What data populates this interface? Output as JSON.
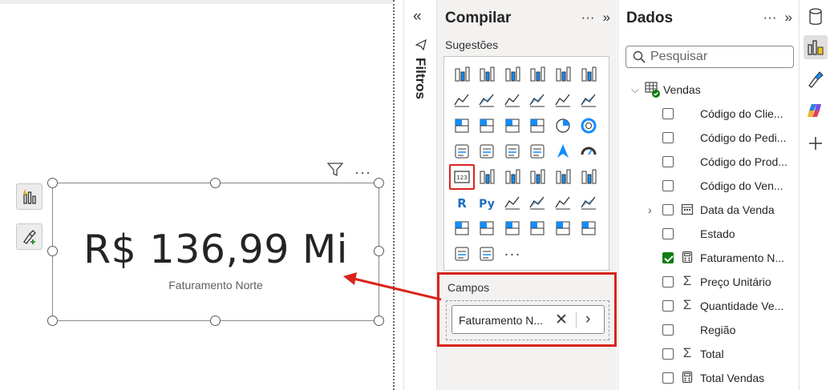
{
  "card": {
    "value": "R$ 136,99 Mi",
    "label": "Faturamento Norte"
  },
  "visual_header": {
    "filter_icon": "funnel-icon",
    "more_label": "···"
  },
  "filters_pane": {
    "title": "Filtros",
    "collapse_label": "«"
  },
  "build_pane": {
    "title": "Compilar",
    "more_label": "···",
    "expand_label": "»",
    "suggestions_label": "Sugestões",
    "viz_more_label": "···",
    "fields_label": "Campos",
    "field_chip": "Faturamento N...",
    "chip_remove": "✕",
    "chip_expand": "›"
  },
  "data_pane": {
    "title": "Dados",
    "more_label": "···",
    "expand_label": "»",
    "search_placeholder": "Pesquisar",
    "table_name": "Vendas",
    "fields": [
      {
        "label": "Código do Clie...",
        "icon": "",
        "checked": false,
        "expandable": false
      },
      {
        "label": "Código do Pedi...",
        "icon": "",
        "checked": false,
        "expandable": false
      },
      {
        "label": "Código do Prod...",
        "icon": "",
        "checked": false,
        "expandable": false
      },
      {
        "label": "Código do Ven...",
        "icon": "",
        "checked": false,
        "expandable": false
      },
      {
        "label": "Data da Venda",
        "icon": "calendar-icon",
        "checked": false,
        "expandable": true
      },
      {
        "label": "Estado",
        "icon": "",
        "checked": false,
        "expandable": false
      },
      {
        "label": "Faturamento N...",
        "icon": "calculator-icon",
        "checked": true,
        "expandable": false
      },
      {
        "label": "Preço Unitário",
        "icon": "sigma-icon",
        "checked": false,
        "expandable": false
      },
      {
        "label": "Quantidade Ve...",
        "icon": "sigma-icon",
        "checked": false,
        "expandable": false
      },
      {
        "label": "Região",
        "icon": "",
        "checked": false,
        "expandable": false
      },
      {
        "label": "Total",
        "icon": "sigma-icon",
        "checked": false,
        "expandable": false
      },
      {
        "label": "Total Vendas",
        "icon": "calculator-icon",
        "checked": false,
        "expandable": false
      }
    ]
  },
  "colors": {
    "highlight": "#d9241c",
    "checked": "#107c10",
    "pane_bg": "#f3f2f1",
    "accent_blue": "#118dff"
  }
}
